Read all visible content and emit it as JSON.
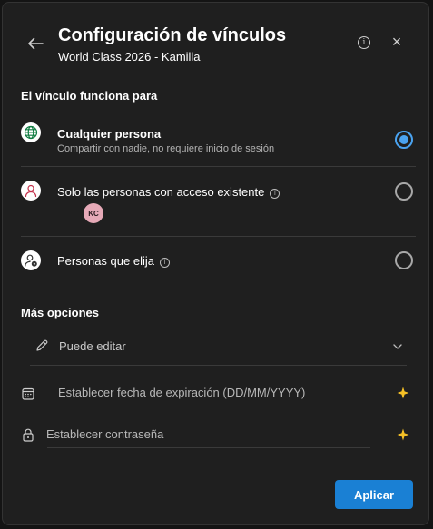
{
  "header": {
    "title": "Configuración de vínculos",
    "subtitle": "World Class 2026 - Kamilla",
    "info_glyph": "i",
    "close_glyph": "×"
  },
  "link_works_for": {
    "label": "El vínculo funciona para",
    "options": [
      {
        "title": "Cualquier persona",
        "description": "Compartir con nadie, no requiere inicio de sesión",
        "icon": "globe-icon",
        "selected": true
      },
      {
        "title": "Solo las personas con acceso existente",
        "icon": "person-icon",
        "selected": false,
        "avatar_initials": "KC"
      },
      {
        "title": "Personas que elija",
        "icon": "person-settings-icon",
        "selected": false
      }
    ]
  },
  "more_options": {
    "label": "Más opciones",
    "permission": {
      "label": "Puede editar",
      "icon": "pencil-icon"
    },
    "expiration": {
      "placeholder": "Establecer fecha de expiración (DD/MM/YYYY)",
      "icon": "calendar-icon",
      "badge_icon": "premium-sparkle-icon"
    },
    "password": {
      "placeholder": "Establecer contraseña",
      "icon": "lock-icon",
      "badge_icon": "premium-sparkle-icon"
    }
  },
  "footer": {
    "apply_label": "Aplicar"
  },
  "colors": {
    "accent": "#1a80d4",
    "radio_selected": "#4aa3f0",
    "premium": "#f5c026",
    "dialog_bg": "#1f1f1f"
  }
}
